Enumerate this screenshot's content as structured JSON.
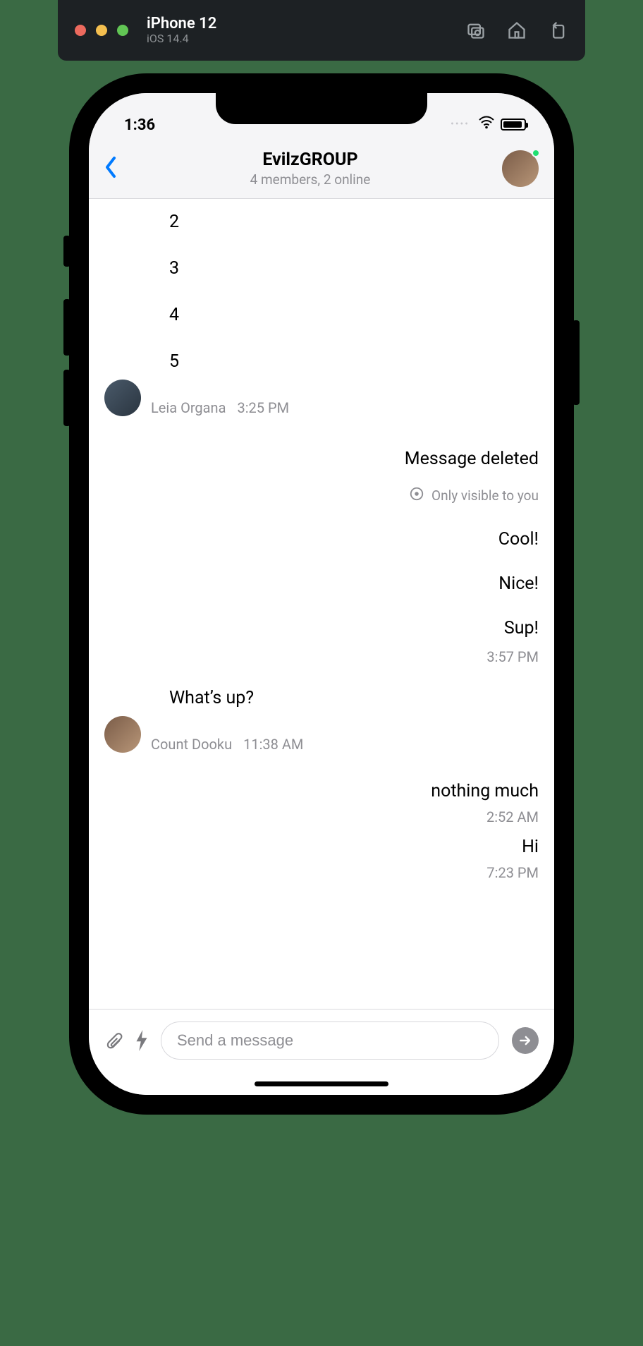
{
  "simulator": {
    "device": "iPhone 12",
    "os": "iOS 14.4",
    "icons": [
      "screenshot-icon",
      "home-icon",
      "rotate-icon"
    ]
  },
  "statusbar": {
    "time": "1:36"
  },
  "header": {
    "title": "EvilzGROUP",
    "subtitle": "4 members, 2 online"
  },
  "messages": {
    "leia_block": {
      "lines": [
        "2",
        "3",
        "4",
        "5"
      ],
      "sender": "Leia Organa",
      "time": "3:25 PM"
    },
    "deleted": {
      "label": "Message deleted",
      "note": "Only visible to you"
    },
    "out_cool": "Cool!",
    "out_nice": "Nice!",
    "out_sup": "Sup!",
    "out_sup_time": "3:57 PM",
    "dooku_block": {
      "text": "What’s up?",
      "sender": "Count Dooku",
      "time": "11:38 AM"
    },
    "out_nothing": "nothing much",
    "out_nothing_time": "2:52 AM",
    "out_hi": "Hi",
    "out_hi_time": "7:23 PM"
  },
  "composer": {
    "placeholder": "Send a message"
  }
}
